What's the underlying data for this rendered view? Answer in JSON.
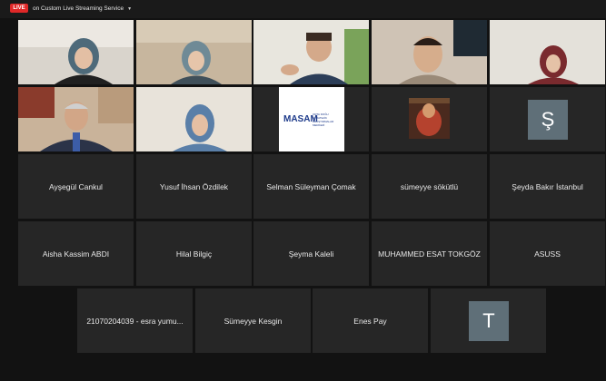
{
  "topbar": {
    "live": "LIVE",
    "stream": "on Custom Live Streaming Service"
  },
  "logo": {
    "name": "MASAM",
    "sub": "ORTA DOĞU STRATEJİK ARAŞTIRMALAR MERKEZİ"
  },
  "avatars": {
    "seyda": "Ş",
    "t": "T"
  },
  "names": {
    "n1": "Ayşegül Cankul",
    "n2": "Yusuf İhsan Özdilek",
    "n3": "Selman Süleyman Çomak",
    "n4": "sümeyye sökütlü",
    "n5": "Şeyda Bakır İstanbul",
    "n6": "Aisha Kassim ABDI",
    "n7": "Hilal Bilgiç",
    "n8": "Şeyma Kaleli",
    "n9": "MUHAMMED ESAT TOKGÖZ",
    "n10": "ASUSS",
    "n11": "21070204039 - esra yumu...",
    "n12": "Sümeyye Kesgin",
    "n13": "Enes Pay"
  }
}
